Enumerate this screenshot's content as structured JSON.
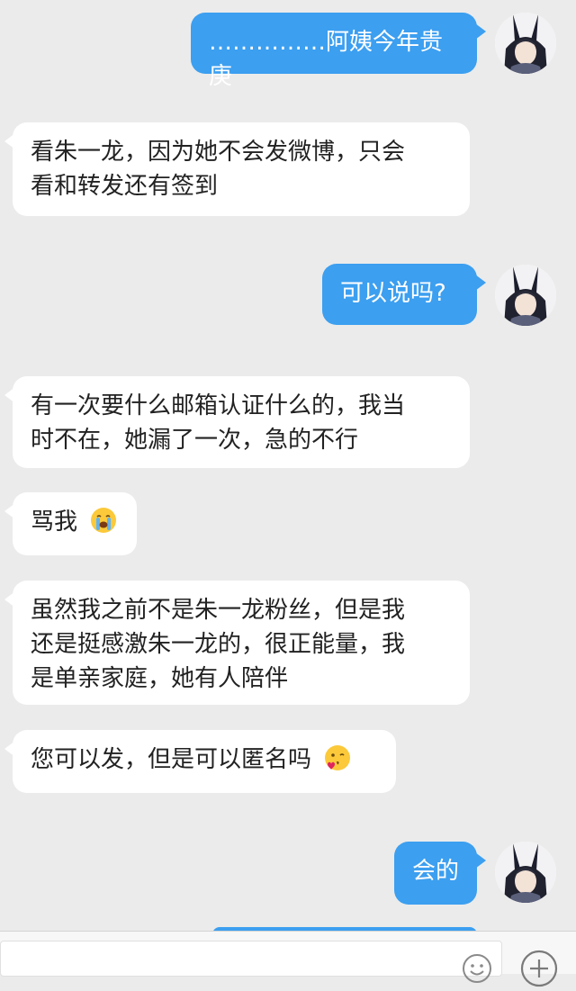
{
  "messages": [
    {
      "id": "m1",
      "direction": "outgoing",
      "text": "……………阿姨今年贵庚"
    },
    {
      "id": "m2",
      "direction": "incoming",
      "lines": [
        "看朱一龙，因为她不会发微博，只会",
        "看和转发还有签到"
      ]
    },
    {
      "id": "m3",
      "direction": "outgoing",
      "text": "可以说吗?"
    },
    {
      "id": "m4",
      "direction": "incoming",
      "lines": [
        "有一次要什么邮箱认证什么的，我当",
        "时不在，她漏了一次，急的不行"
      ]
    },
    {
      "id": "m5",
      "direction": "incoming",
      "text": "骂我",
      "emoji": "loudly-crying-face"
    },
    {
      "id": "m6",
      "direction": "incoming",
      "lines": [
        "虽然我之前不是朱一龙粉丝，但是我",
        "还是挺感激朱一龙的，很正能量，我",
        "是单亲家庭，她有人陪伴"
      ]
    },
    {
      "id": "m7",
      "direction": "incoming",
      "text": "您可以发，但是可以匿名吗",
      "emoji": "face-blowing-kiss"
    },
    {
      "id": "m8",
      "direction": "outgoing",
      "text": "会的"
    }
  ],
  "colors": {
    "background": "#ebebeb",
    "outgoing_bubble": "#3c9ff0",
    "incoming_bubble": "#ffffff",
    "outgoing_text": "#ffffff",
    "incoming_text": "#222222"
  },
  "input_bar": {
    "emoji_icon": "smiley-face-icon",
    "plus_icon": "plus-circle-icon"
  }
}
